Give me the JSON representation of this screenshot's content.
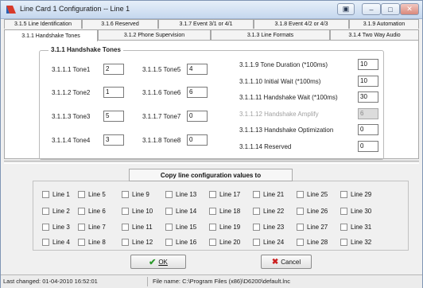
{
  "window": {
    "title": "Line Card 1 Configuration  --  Line 1",
    "controls": {
      "help": "▣",
      "minimize": "–",
      "maximize": "□",
      "close": "✕"
    }
  },
  "tabs": {
    "row1": [
      {
        "label": "3.1.5 Line Identification"
      },
      {
        "label": "3.1.6 Reserved"
      },
      {
        "label": "3.1.7 Event 3/1 or 4/1"
      },
      {
        "label": "3.1.8 Event 4/2 or 4/3"
      },
      {
        "label": "3.1.9 Automation"
      }
    ],
    "row2": [
      {
        "label": "3.1.1 Handshake Tones",
        "active": true
      },
      {
        "label": "3.1.2 Phone Supervision"
      },
      {
        "label": "3.1.3 Line Formats"
      },
      {
        "label": "3.1.4 Two Way Audio"
      }
    ]
  },
  "handshake": {
    "title": "3.1.1 Handshake Tones",
    "tones": [
      {
        "label": "3.1.1.1 Tone1",
        "value": "2"
      },
      {
        "label": "3.1.1.2 Tone2",
        "value": "1"
      },
      {
        "label": "3.1.1.3 Tone3",
        "value": "5"
      },
      {
        "label": "3.1.1.4 Tone4",
        "value": "3"
      },
      {
        "label": "3.1.1.5 Tone5",
        "value": "4"
      },
      {
        "label": "3.1.1.6 Tone6",
        "value": "6"
      },
      {
        "label": "3.1.1.7 Tone7",
        "value": "0"
      },
      {
        "label": "3.1.1.8 Tone8",
        "value": "0"
      }
    ],
    "params": [
      {
        "label": "3.1.1.9 Tone Duration (*100ms)",
        "value": "10"
      },
      {
        "label": "3.1.1.10 Initial Wait (*100ms)",
        "value": "10"
      },
      {
        "label": "3.1.1.11 Handshake Wait (*100ms)",
        "value": "30"
      },
      {
        "label": "3.1.1.12 Handshake Amplify",
        "value": "6",
        "disabled": true
      },
      {
        "label": "3.1.1.13 Handshake Optimization",
        "value": "0"
      },
      {
        "label": "3.1.1.14 Reserved",
        "value": "0"
      }
    ]
  },
  "copy": {
    "header": "Copy line configuration values to",
    "lines": [
      "Line 1",
      "Line 2",
      "Line 3",
      "Line 4",
      "Line 5",
      "Line 6",
      "Line 7",
      "Line 8",
      "Line 9",
      "Line 10",
      "Line 11",
      "Line 12",
      "Line 13",
      "Line 14",
      "Line 15",
      "Line 16",
      "Line 17",
      "Line 18",
      "Line 19",
      "Line 20",
      "Line 21",
      "Line 22",
      "Line 23",
      "Line 24",
      "Line 25",
      "Line 26",
      "Line 27",
      "Line 28",
      "Line 29",
      "Line 30",
      "Line 31",
      "Line 32"
    ]
  },
  "buttons": {
    "ok": "OK",
    "cancel": "Cancel"
  },
  "status": {
    "last_changed": "Last changed: 01-04-2010 16:52:01",
    "file_name": "File name: C:\\Program Files (x86)\\D6200\\default.lnc"
  },
  "colors": {
    "ok_check": "#2c9a2c",
    "cancel_x": "#cc2020",
    "title_bar": "#c5d7ee"
  }
}
